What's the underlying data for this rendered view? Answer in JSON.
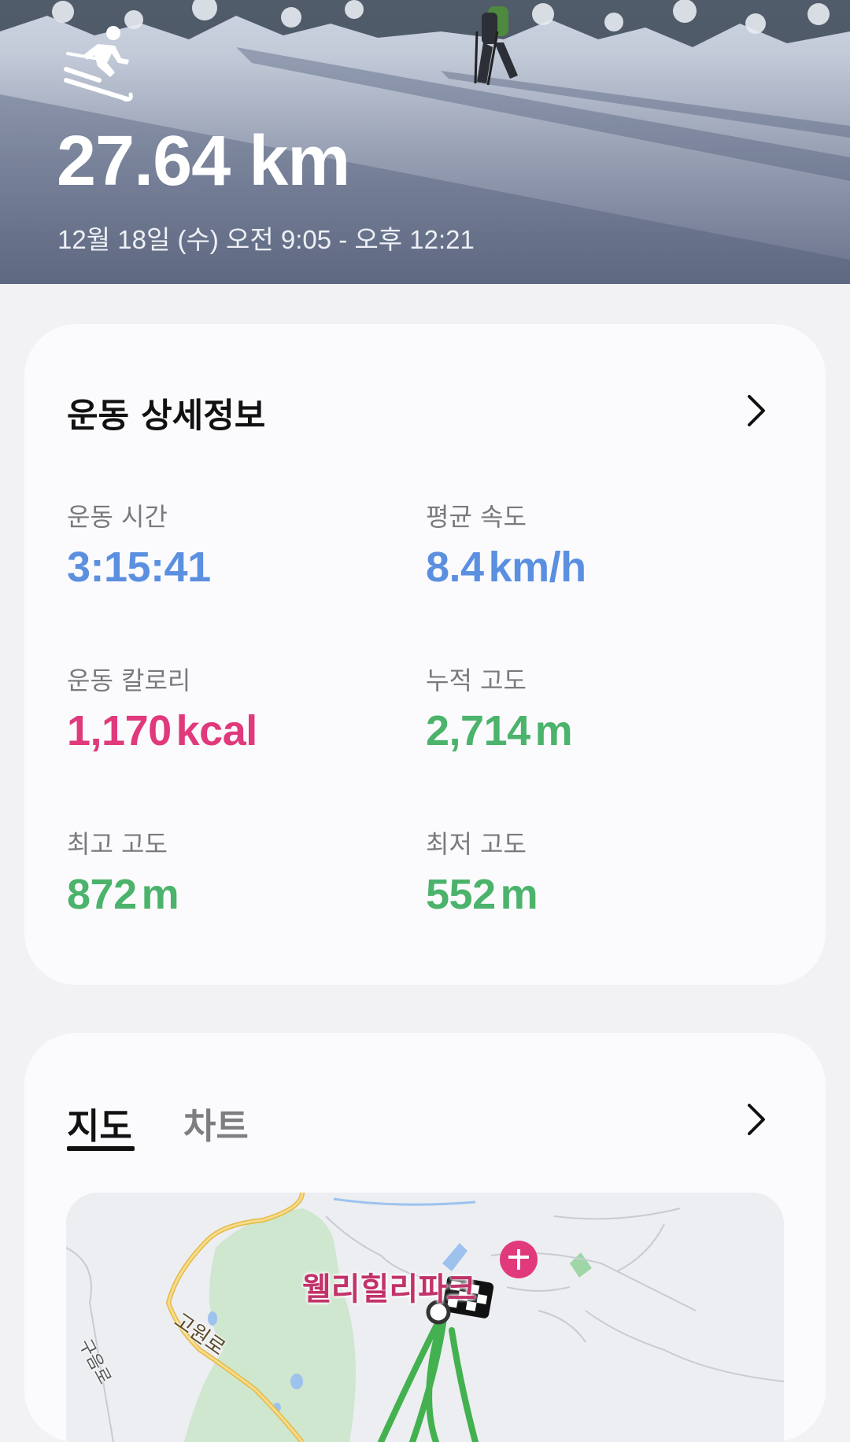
{
  "hero": {
    "activity_icon": "skiing-icon",
    "distance": "27.64 km",
    "time_range": "12월 18일 (수) 오전 9:05 - 오후 12:21"
  },
  "details": {
    "title": "운동 상세정보",
    "stats": [
      {
        "label": "운동 시간",
        "value": "3:15:41",
        "unit": "",
        "color": "#5b8fe0"
      },
      {
        "label": "평균 속도",
        "value": "8.4",
        "unit": "km/h",
        "color": "#5b8fe0"
      },
      {
        "label": "운동 칼로리",
        "value": "1,170",
        "unit": "kcal",
        "color": "#e0397c"
      },
      {
        "label": "누적 고도",
        "value": "2,714",
        "unit": "m",
        "color": "#4bb36b"
      },
      {
        "label": "최고 고도",
        "value": "872",
        "unit": "m",
        "color": "#4bb36b"
      },
      {
        "label": "최저 고도",
        "value": "552",
        "unit": "m",
        "color": "#4bb36b"
      }
    ]
  },
  "map_card": {
    "tabs": [
      "지도",
      "차트"
    ],
    "active_tab": "지도",
    "poi_label": "웰리힐리파크",
    "road_labels": [
      "고원로",
      "구음로"
    ]
  }
}
